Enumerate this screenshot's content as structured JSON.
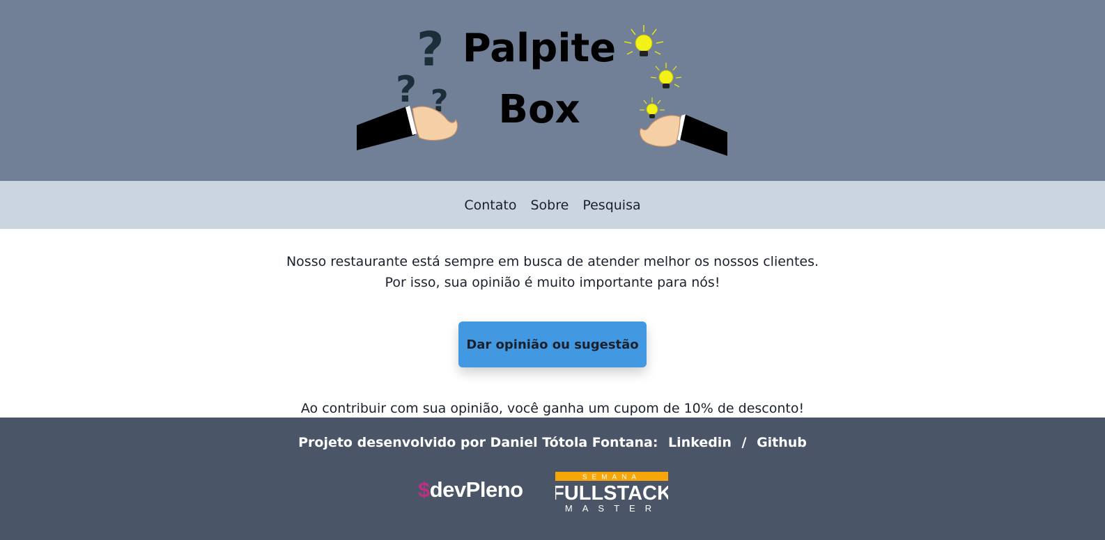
{
  "header": {
    "logo_title_line1": "Palpite",
    "logo_title_line2": "Box"
  },
  "nav": {
    "items": [
      "Contato",
      "Sobre",
      "Pesquisa"
    ]
  },
  "main": {
    "intro_line1": "Nosso restaurante está sempre em busca de atender melhor os nossos clientes.",
    "intro_line2": "Por isso, sua opinião é muito importante para nós!",
    "cta_label": "Dar opinião ou sugestão",
    "coupon_text": "Ao contribuir com sua opinião, você ganha um cupom de 10% de desconto!"
  },
  "footer": {
    "credit_text": "Projeto desenvolvido por Daniel Tótola Fontana:",
    "linkedin_label": "Linkedin",
    "separator": "/",
    "github_label": "Github",
    "devpleno_symbol": "$",
    "devpleno_name": "devPleno",
    "fsm_top": "SEMANA",
    "fsm_middle": "FULLSTACK",
    "fsm_bottom": "MASTER"
  },
  "colors": {
    "header_bg": "#718096",
    "nav_bg": "#cbd5e0",
    "cta_bg": "#4299e1",
    "footer_bg": "#4a5568",
    "devpleno_accent": "#b83280",
    "semana_band": "#f6a609"
  }
}
